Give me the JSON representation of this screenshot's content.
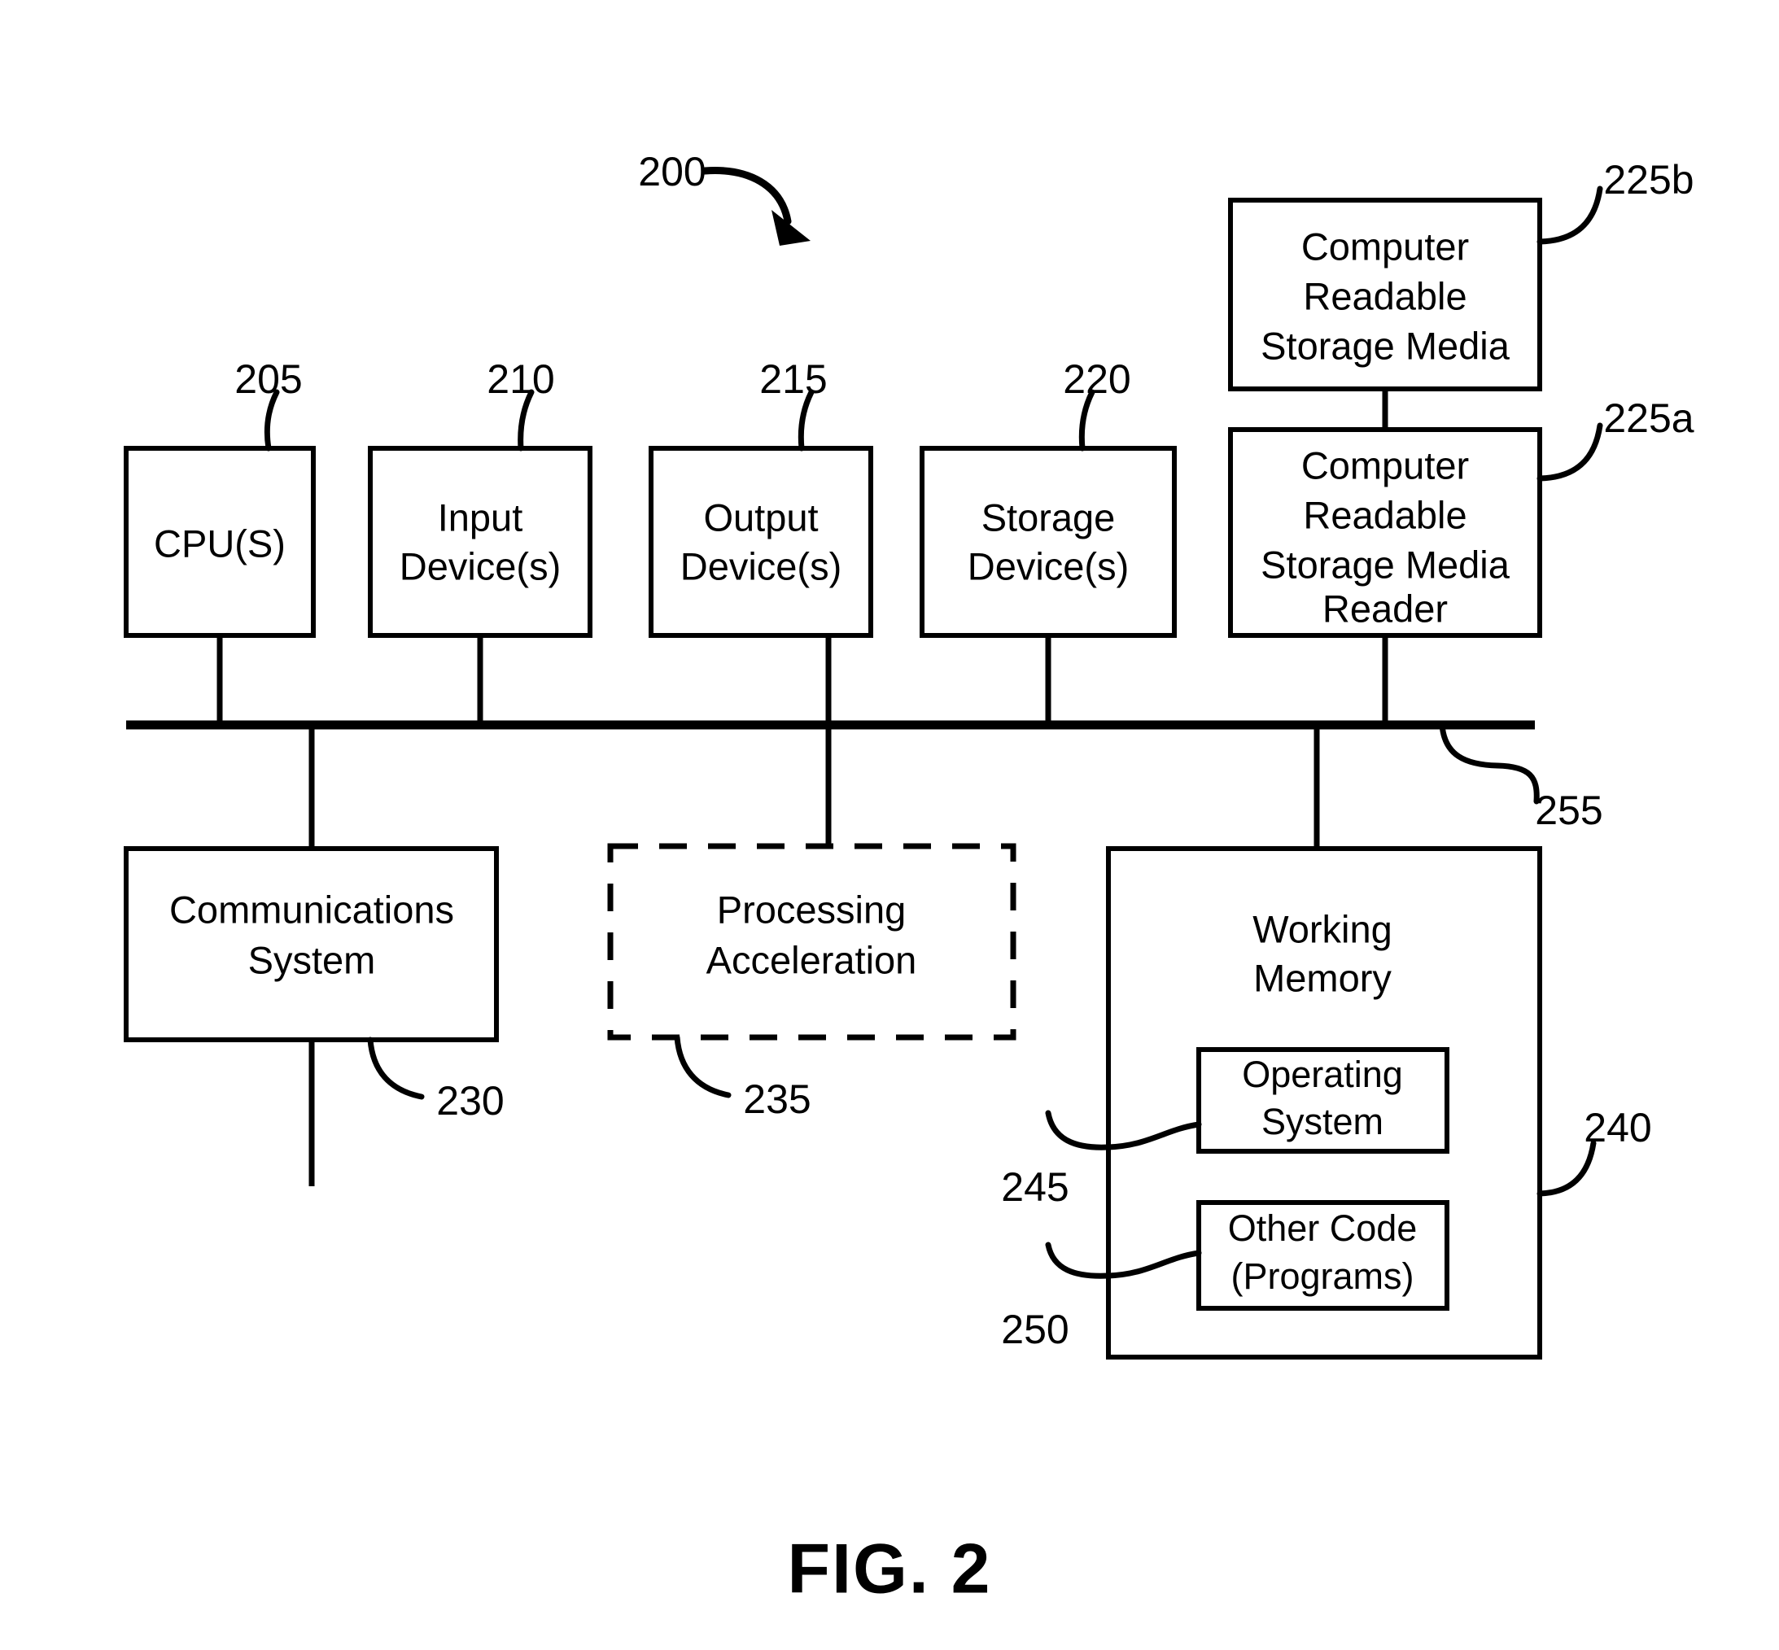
{
  "figure": {
    "caption": "FIG. 2",
    "system_ref": "200"
  },
  "blocks": {
    "cpu": {
      "line1": "CPU(S)",
      "ref": "205"
    },
    "input_device": {
      "line1": "Input",
      "line2": "Device(s)",
      "ref": "210"
    },
    "output_device": {
      "line1": "Output",
      "line2": "Device(s)",
      "ref": "215"
    },
    "storage_device": {
      "line1": "Storage",
      "line2": "Device(s)",
      "ref": "220"
    },
    "crsm": {
      "line1": "Computer",
      "line2": "Readable",
      "line3": "Storage Media",
      "ref": "225b"
    },
    "crsm_reader": {
      "line1": "Computer",
      "line2": "Readable",
      "line3": "Storage Media",
      "line4": "Reader",
      "ref": "225a"
    },
    "communications_system": {
      "line1": "Communications",
      "line2": "System",
      "ref": "230"
    },
    "processing_acceleration": {
      "line1": "Processing",
      "line2": "Acceleration",
      "ref": "235",
      "style": "dashed"
    },
    "working_memory": {
      "line1": "Working",
      "line2": "Memory",
      "ref": "240"
    },
    "operating_system": {
      "line1": "Operating",
      "line2": "System",
      "ref": "245"
    },
    "other_code": {
      "line1": "Other Code",
      "line2": "(Programs)",
      "ref": "250"
    },
    "bus": {
      "ref": "255"
    }
  },
  "colors": {
    "stroke": "#000000",
    "fill": "#ffffff",
    "background": "#ffffff"
  }
}
